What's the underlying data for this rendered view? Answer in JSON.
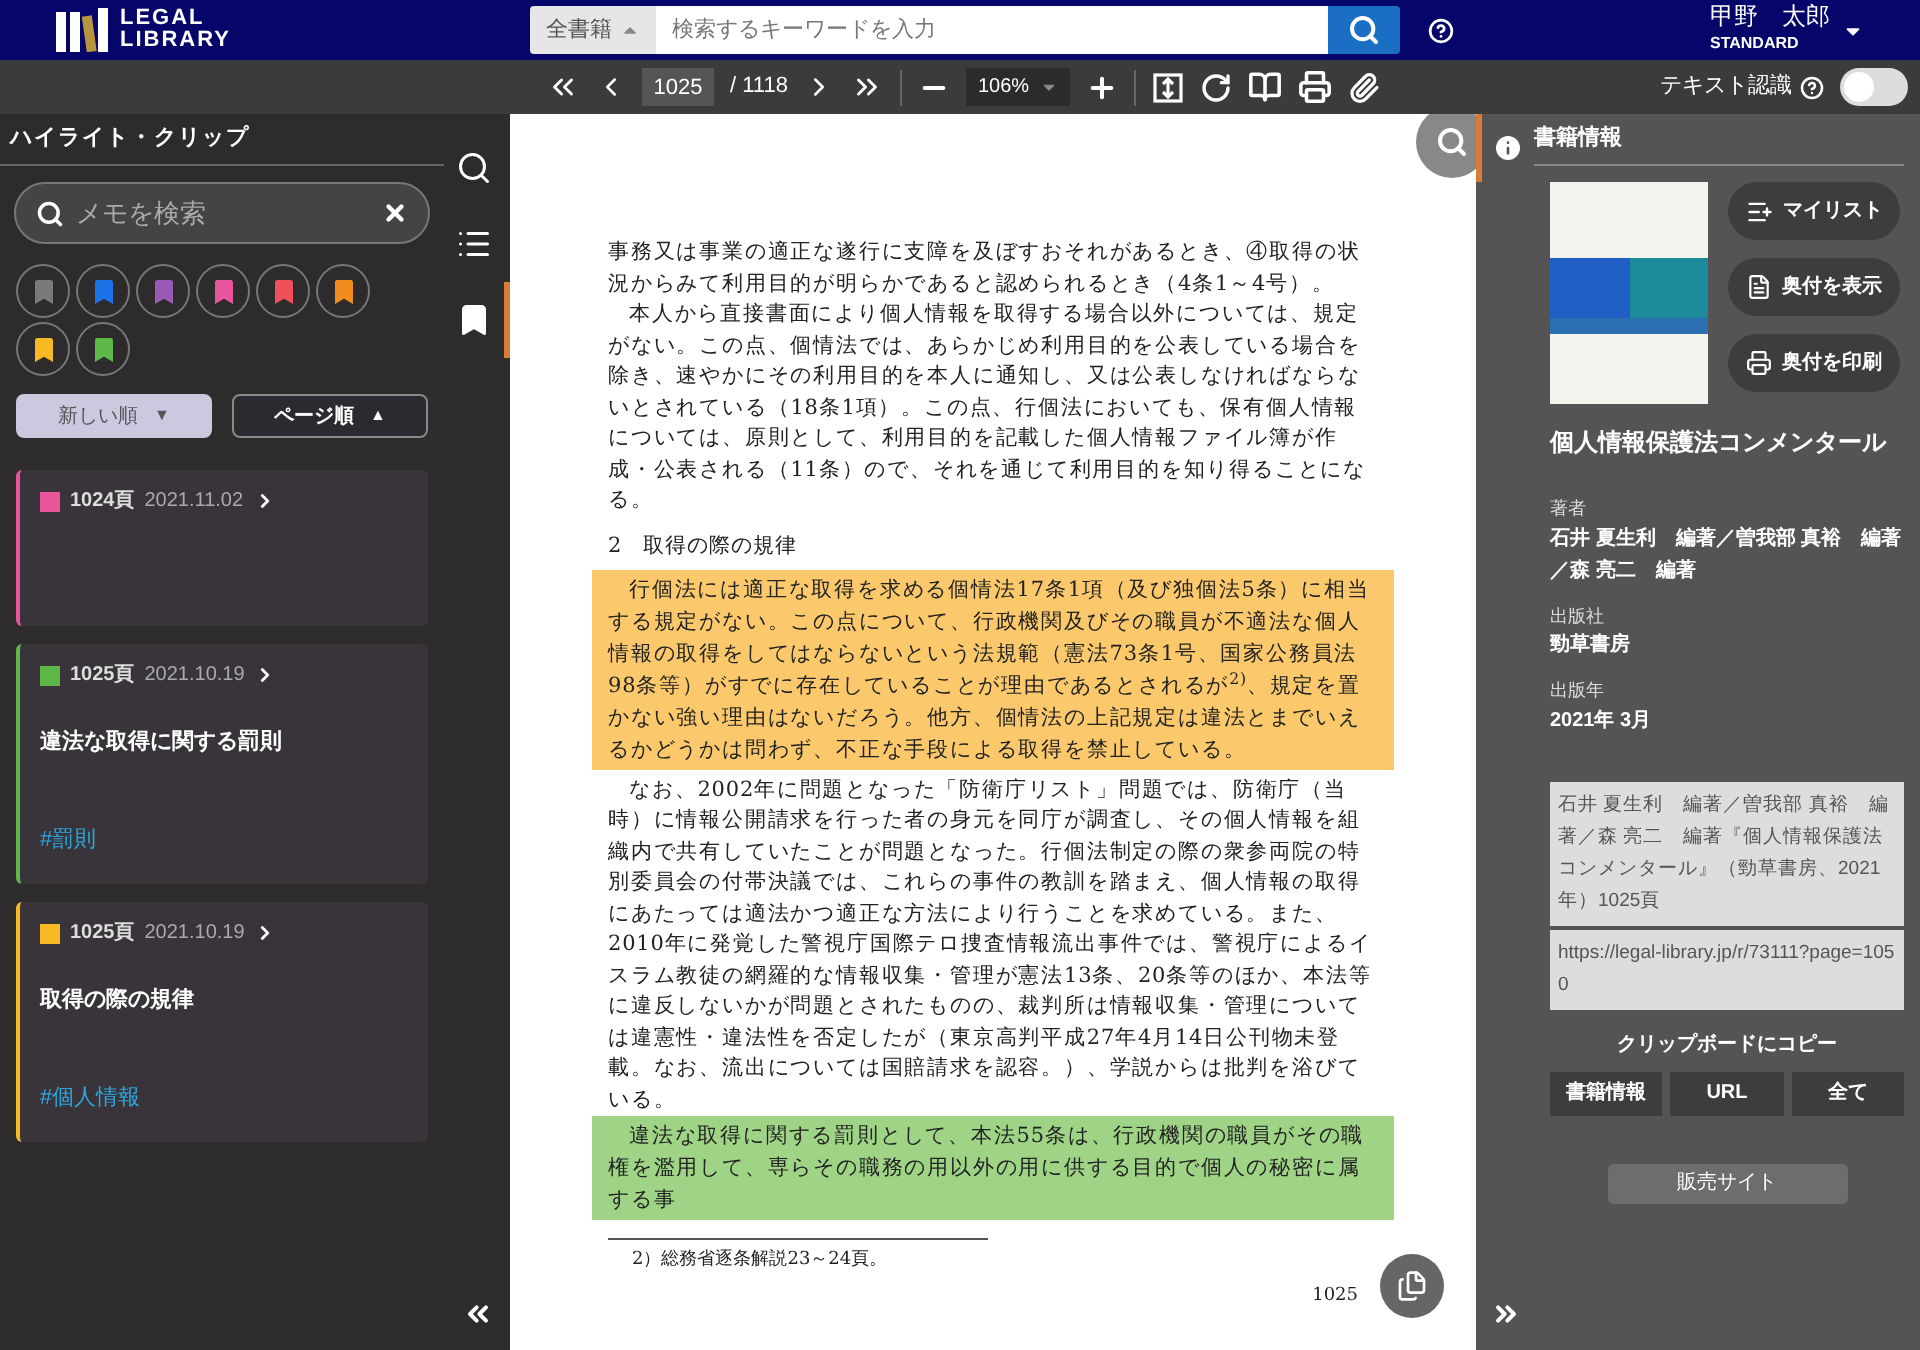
{
  "header": {
    "logo": [
      "LEGAL",
      "LIBRARY"
    ],
    "scope": "全書籍",
    "search_placeholder": "検索するキーワードを入力",
    "user": {
      "name": "甲野　太郎",
      "plan": "STANDARD"
    }
  },
  "toolbar": {
    "page": "1025",
    "total": "/ 1118",
    "zoom": "106%",
    "text_recognition": "テキスト認識",
    "text_recognition_on": false
  },
  "left_rail": [
    {
      "kind": "search",
      "selected": false
    },
    {
      "kind": "list",
      "selected": false
    },
    {
      "kind": "bookmark",
      "selected": true
    }
  ],
  "clips": {
    "title": "ハイライト・クリップ",
    "search_placeholder": "メモを検索",
    "filters": [
      {
        "color": "#7a7a7a"
      },
      {
        "color": "#1a73e8"
      },
      {
        "color": "#9b59b6"
      },
      {
        "color": "#e8559a"
      },
      {
        "color": "#f0505a"
      },
      {
        "color": "#f28c1c"
      },
      {
        "color": "#f7b924"
      },
      {
        "color": "#5cb947"
      }
    ],
    "sorts": [
      {
        "label": "新しい順",
        "selected": true,
        "arrow": "▼"
      },
      {
        "label": "ページ順",
        "selected": false,
        "arrow": "▲"
      }
    ],
    "items": [
      {
        "color": "#e8559a",
        "page": "1024頁",
        "date": "2021.11.02"
      },
      {
        "color": "#5cb947",
        "page": "1025頁",
        "date": "2021.10.19",
        "memo": "違法な取得に関する罰則",
        "tag": "#罰則"
      },
      {
        "color": "#f7b924",
        "page": "1025頁",
        "date": "2021.10.19",
        "memo": "取得の際の規律",
        "tag": "#個人情報"
      }
    ]
  },
  "document": {
    "blocks": [
      {
        "kind": "paragraph",
        "indent": false,
        "text": "事務又は事業の適正な遂行に支障を及ぼすおそれがあるとき、④取得の状況からみて利用目的が明らかであると認められるとき（4条1～4号）。"
      },
      {
        "kind": "paragraph",
        "indent": true,
        "text": "本人から直接書面により個人情報を取得する場合以外については、規定がない。この点、個情法では、あらかじめ利用目的を公表している場合を除き、速やかにその利用目的を本人に通知し、又は公表しなければならないとされている（18条1項）。この点、行個法においても、保有個人情報については、原則として、利用目的を記載した個人情報ファイル簿が作成・公表される（11条）ので、それを通じて利用目的を知り得ることになる。"
      },
      {
        "kind": "heading",
        "text": "2　取得の際の規律"
      },
      {
        "kind": "paragraph",
        "indent": true,
        "color": "#fbc96b",
        "text": "行個法には適正な取得を求める個情法17条1項（及び独個法5条）に相当する規定がない。この点について、行政機関及びその職員が不適法な個人情報の取得をしてはならないという法規範（憲法73条1号、国家公務員法98条等）がすでに存在していることが理由であるとされるが$^{2)}$、規定を置かない強い理由はないだろう。他方、個情法の上記規定は違法とまでいえるかどうかは問わず、不正な手段による取得を禁止している。"
      },
      {
        "kind": "paragraph",
        "indent": true,
        "text": "なお、2002年に問題となった「防衛庁リスト」問題では、防衛庁（当時）に情報公開請求を行った者の身元を同庁が調査し、その個人情報を組織内で共有していたことが問題となった。行個法制定の際の衆参両院の特別委員会の付帯決議では、これらの事件の教訓を踏まえ、個人情報の取得にあたっては適法かつ適正な方法により行うことを求めている。また、2010年に発覚した警視庁国際テロ捜査情報流出事件では、警視庁によるイスラム教徒の網羅的な情報収集・管理が憲法13条、20条等のほか、本法等に違反しないかが問題とされたものの、裁判所は情報収集・管理については違憲性・違法性を否定したが（東京高判平成27年4月14日公刊物未登載。なお、流出については国賠請求を認容。）、学説からは批判を浴びている。"
      },
      {
        "kind": "paragraph",
        "indent": true,
        "color": "#9fd486",
        "text": "違法な取得に関する罰則として、本法55条は、行政機関の職員がその職権を濫用して、専らその職務の用以外の用に供する目的で個人の秘密に属する事"
      }
    ],
    "footnote": "2）総務省逐条解説23～24頁。",
    "page_number": "1025"
  },
  "book": {
    "title_label": "書籍情報",
    "actions": [
      {
        "kind": "mylist",
        "label": "マイリスト"
      },
      {
        "kind": "view",
        "label": "奥付を表示"
      },
      {
        "kind": "print",
        "label": "奥付を印刷"
      }
    ],
    "title": "個人情報保護法コンメンタール",
    "fields": [
      {
        "label": "著者",
        "value": "石井 夏生利　編著／曽我部 真裕　編著／森 亮二　編著"
      },
      {
        "label": "出版社",
        "value": "勁草書房"
      },
      {
        "label": "出版年",
        "value": "2021年 3月"
      }
    ],
    "citation": "石井 夏生利　編著／曽我部 真裕　編著／森 亮二　編著『個人情報保護法コンメンタール』（勁草書房、2021年）1025頁",
    "url": "https://legal-library.jp/r/73111?page=1050",
    "copy_label": "クリップボードにコピー",
    "copy_buttons": [
      "書籍情報",
      "URL",
      "全て"
    ],
    "shop": "販売サイト"
  }
}
